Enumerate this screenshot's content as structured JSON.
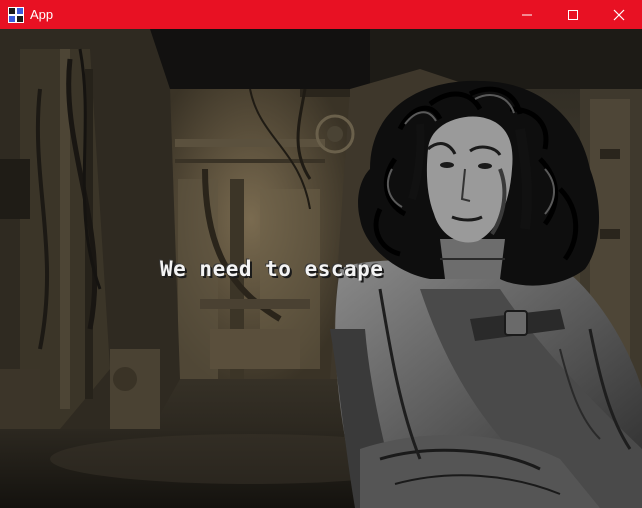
{
  "window": {
    "title": "App",
    "titlebar_color": "#e81123",
    "icons": {
      "app": "app-icon",
      "minimize": "minimize-icon",
      "maximize": "maximize-icon",
      "close": "close-icon"
    }
  },
  "game": {
    "dialogue_text": "We need to escape",
    "background": "spaceship-corridor",
    "character": "heroine-portrait"
  }
}
